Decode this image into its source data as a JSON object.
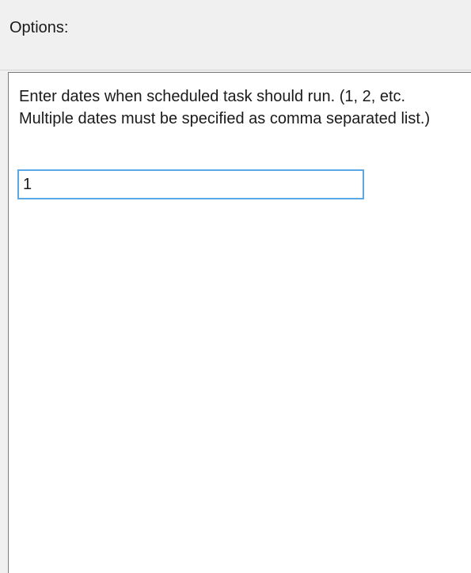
{
  "header": {
    "title": "Options:"
  },
  "options": {
    "instructions": "Enter dates when scheduled task should run. (1, 2, etc. Multiple dates must be specified as comma separated list.)",
    "dates_value": "1"
  }
}
